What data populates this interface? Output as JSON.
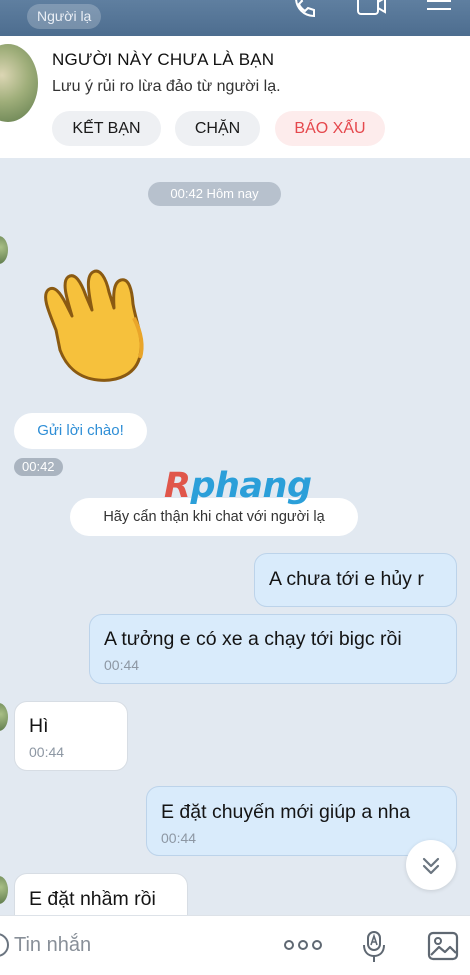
{
  "header": {
    "stranger_chip": "Người lạ",
    "icons": [
      "phone-icon",
      "video-call-icon",
      "menu-icon"
    ]
  },
  "stranger_card": {
    "title": "NGƯỜI NÀY CHƯA LÀ BẠN",
    "subtitle": "Lưu ý rủi ro lừa đảo từ người lạ.",
    "buttons": [
      {
        "label": "KẾT BẠN"
      },
      {
        "label": "CHẶN"
      },
      {
        "label": "BÁO XẤU",
        "color": "#e5484d"
      }
    ]
  },
  "chat": {
    "date_pill": "00:42 Hôm nay",
    "sticker": "waving-hand-sticker",
    "greeting_button": "Gửi lời chào!",
    "greeting_time": "00:42",
    "safety_notice": "Hãy cẩn thận khi chat với người lạ",
    "watermark": {
      "first": "R",
      "rest": "phang"
    },
    "messages": [
      {
        "side": "me",
        "text": "A chưa tới e hủy r",
        "time": ""
      },
      {
        "side": "me",
        "text": "A tưởng e có xe a chạy tới bigc rồi",
        "time": "00:44"
      },
      {
        "side": "them",
        "text": "Hì",
        "time": "00:44"
      },
      {
        "side": "me",
        "text": "E đặt chuyến mới giúp a nha",
        "time": "00:44"
      },
      {
        "side": "them",
        "text": "E đặt nhầm rồi",
        "time": ""
      }
    ]
  },
  "composer": {
    "placeholder": "Tin nhắn",
    "icons": [
      "more-icon",
      "voice-to-text-icon",
      "image-icon"
    ]
  },
  "colors": {
    "topbar": "#4d6d8f",
    "chat_background": "#e2e9f1",
    "my_bubble": "#d9ebfb",
    "their_bubble": "#ffffff",
    "link_blue": "#2e8ed6",
    "danger_red": "#e5484d"
  }
}
